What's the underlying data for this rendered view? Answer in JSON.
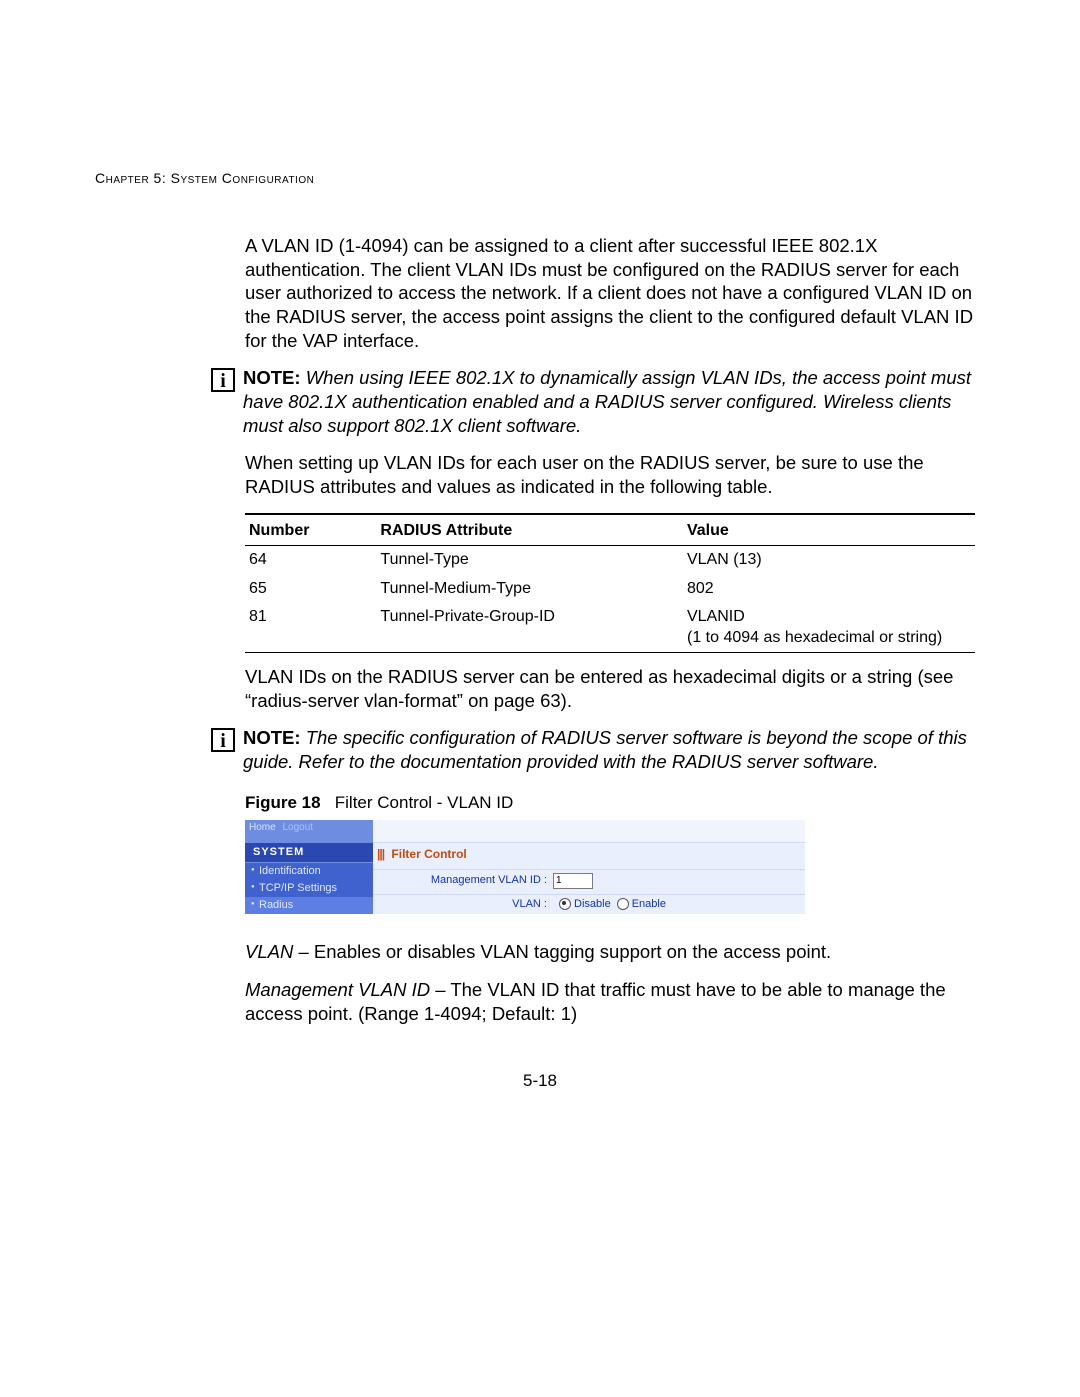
{
  "header": {
    "running": "Chapter 5: System Configuration"
  },
  "body": {
    "intro": "A VLAN ID (1-4094) can be assigned to a client after successful IEEE 802.1X authentication. The client VLAN IDs must be configured on the RADIUS server for each user authorized to access the network. If a client does not have a configured VLAN ID on the RADIUS server, the access point assigns the client to the configured default VLAN ID for the VAP interface.",
    "note1_label": "NOTE:",
    "note1_text": "When using IEEE 802.1X to dynamically assign VLAN IDs, the access point must have 802.1X authentication enabled and a RADIUS server configured. Wireless clients must also support 802.1X client software.",
    "radius_intro": "When setting up VLAN IDs for each user on the RADIUS server, be sure to use the RADIUS attributes and values as indicated in the following table.",
    "radius_hex": "VLAN IDs on the RADIUS server can be entered as hexadecimal digits or a string (see “radius-server vlan-format” on page 63).",
    "note2_label": "NOTE:",
    "note2_text": "The specific configuration of RADIUS server software is beyond the scope of this guide. Refer to the documentation provided with the RADIUS server software.",
    "fig_label": "Figure 18",
    "fig_caption": "Filter Control - VLAN ID",
    "vlan_term": "VLAN",
    "vlan_desc": " – Enables or disables VLAN tagging support on the access point.",
    "mgmt_term": "Management VLAN ID",
    "mgmt_desc": " – The VLAN ID that traffic must have to be able to manage the access point. (Range 1-4094; Default: 1)"
  },
  "table": {
    "headers": {
      "number": "Number",
      "attr": "RADIUS Attribute",
      "value": "Value"
    },
    "rows": [
      {
        "number": "64",
        "attr": "Tunnel-Type",
        "value": "VLAN (13)"
      },
      {
        "number": "65",
        "attr": "Tunnel-Medium-Type",
        "value": "802"
      },
      {
        "number": "81",
        "attr": "Tunnel-Private-Group-ID",
        "value": "VLANID\n(1 to 4094 as hexadecimal or string)"
      }
    ]
  },
  "ui": {
    "tabs_home": "Home",
    "tabs_logout": "Logout",
    "section": "SYSTEM",
    "side_items": [
      "Identification",
      "TCP/IP Settings",
      "Radius"
    ],
    "panel_title": "Filter Control",
    "mgmt_label": "Management VLAN ID  :",
    "mgmt_value": "1",
    "vlan_label": "VLAN  :",
    "opt_disable": "Disable",
    "opt_enable": "Enable"
  },
  "footer": {
    "page": "5-18"
  }
}
